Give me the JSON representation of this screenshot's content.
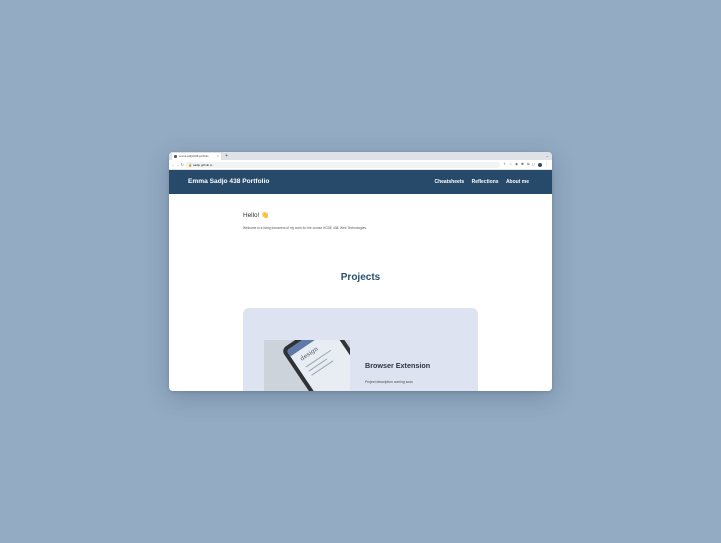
{
  "browser": {
    "tab_title": "emma-sadjo/438-portfolio",
    "tab_close": "×",
    "new_tab": "+",
    "window_controls": "⌄",
    "back": "←",
    "forward": "→",
    "reload": "↻",
    "lock": "🔒",
    "url": "sadjo.github.io",
    "ext_icons": [
      "⇧",
      "☆",
      "◉",
      "✱",
      "⧉",
      "◻"
    ],
    "menu": "⋮"
  },
  "header": {
    "brand": "Emma Sadjo 438 Portfolio",
    "nav": [
      "Cheatsheets",
      "Reflections",
      "About me"
    ]
  },
  "intro": {
    "greeting": "Hello! 👋",
    "welcome": "Welcome to a living document of my work for the course HCDE 438: Web Technologies."
  },
  "projects": {
    "title": "Projects",
    "cards": [
      {
        "image_text": "design",
        "title": "Browser Extension",
        "description": "Project description coming soon"
      }
    ]
  },
  "colors": {
    "background": "#93abc3",
    "header": "#27496a",
    "card": "#dde3f0",
    "accent_title": "#29506f"
  }
}
